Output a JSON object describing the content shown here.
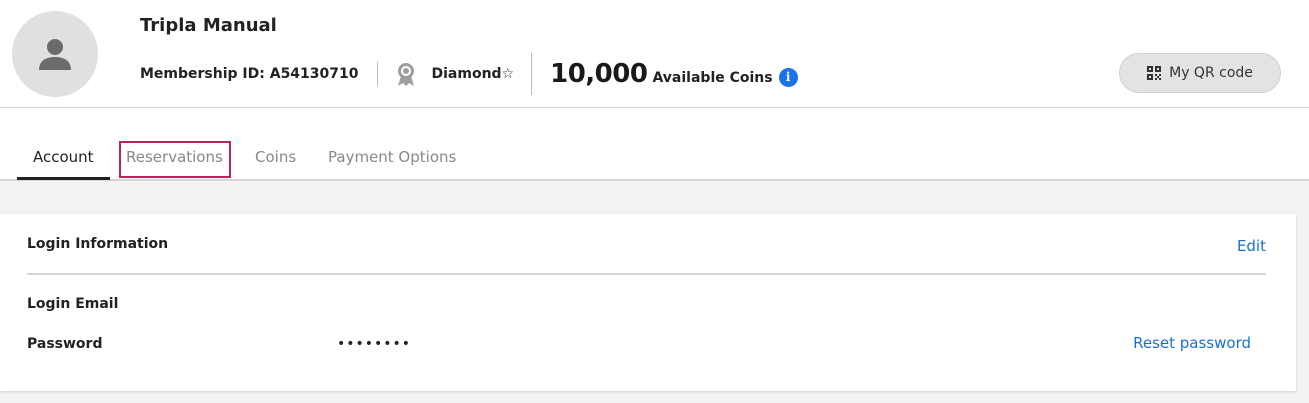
{
  "profile": {
    "name": "Tripla Manual",
    "membership_id": "Membership ID: A54130710",
    "rank": "Diamond☆",
    "coins_value": "10,000",
    "coins_label": "Available Coins",
    "info_glyph": "i",
    "qr_button_label": "My QR code"
  },
  "tabs": [
    {
      "label": "Account",
      "active": true
    },
    {
      "label": "Reservations",
      "active": false
    },
    {
      "label": "Coins",
      "active": false
    },
    {
      "label": "Payment Options",
      "active": false
    }
  ],
  "login_info": {
    "title": "Login Information",
    "edit_label": "Edit",
    "email_label": "Login Email",
    "email_value": "",
    "password_label": "Password",
    "password_value": "••••••••",
    "reset_label": "Reset password"
  },
  "colors": {
    "link": "#1a6fd1",
    "info_icon": "#1a73e8",
    "highlight_border": "#b8245c",
    "page_background": "#f4f3f1"
  },
  "icons": [
    "user-avatar-icon",
    "ribbon-badge-icon",
    "info-icon",
    "qr-code-icon"
  ]
}
